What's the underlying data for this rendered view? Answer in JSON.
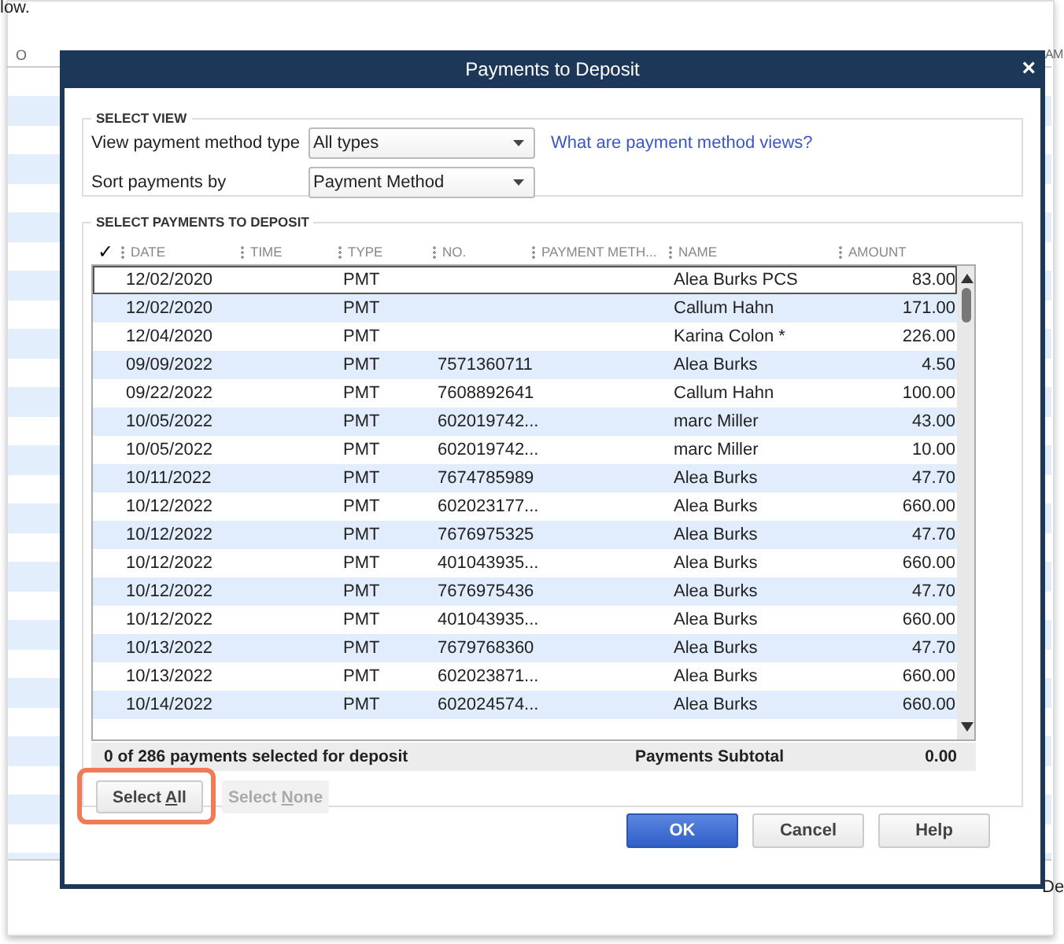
{
  "background": {
    "text_top": "low.",
    "column_left": "O",
    "column_right": "AM",
    "text_bottom": "De"
  },
  "dialog": {
    "title": "Payments to Deposit",
    "close": "×"
  },
  "select_view": {
    "legend": "SELECT VIEW",
    "fields": [
      {
        "label": "View payment method type",
        "value": "All types"
      },
      {
        "label": "Sort payments by",
        "value": "Payment Method"
      }
    ],
    "help_link": "What are payment method views?"
  },
  "payments": {
    "legend": "SELECT PAYMENTS TO DEPOSIT",
    "columns": [
      "✓",
      "DATE",
      "TIME",
      "TYPE",
      "NO.",
      "PAYMENT METH...",
      "NAME",
      "AMOUNT"
    ],
    "rows": [
      {
        "focused": true,
        "date": "12/02/2020",
        "type": "PMT",
        "no": "",
        "name": "Alea Burks PCS",
        "amount": "83.00"
      },
      {
        "focused": false,
        "date": "12/02/2020",
        "type": "PMT",
        "no": "",
        "name": "Callum Hahn",
        "amount": "171.00"
      },
      {
        "focused": false,
        "date": "12/04/2020",
        "type": "PMT",
        "no": "",
        "name": "Karina Colon *",
        "amount": "226.00"
      },
      {
        "focused": false,
        "date": "09/09/2022",
        "type": "PMT",
        "no": "7571360711",
        "name": "Alea Burks",
        "amount": "4.50"
      },
      {
        "focused": false,
        "date": "09/22/2022",
        "type": "PMT",
        "no": "7608892641",
        "name": "Callum Hahn",
        "amount": "100.00"
      },
      {
        "focused": false,
        "date": "10/05/2022",
        "type": "PMT",
        "no": "602019742...",
        "name": "marc Miller",
        "amount": "43.00"
      },
      {
        "focused": false,
        "date": "10/05/2022",
        "type": "PMT",
        "no": "602019742...",
        "name": "marc Miller",
        "amount": "10.00"
      },
      {
        "focused": false,
        "date": "10/11/2022",
        "type": "PMT",
        "no": "7674785989",
        "name": "Alea Burks",
        "amount": "47.70"
      },
      {
        "focused": false,
        "date": "10/12/2022",
        "type": "PMT",
        "no": "602023177...",
        "name": "Alea Burks",
        "amount": "660.00"
      },
      {
        "focused": false,
        "date": "10/12/2022",
        "type": "PMT",
        "no": "7676975325",
        "name": "Alea Burks",
        "amount": "47.70"
      },
      {
        "focused": false,
        "date": "10/12/2022",
        "type": "PMT",
        "no": "401043935...",
        "name": "Alea Burks",
        "amount": "660.00"
      },
      {
        "focused": false,
        "date": "10/12/2022",
        "type": "PMT",
        "no": "7676975436",
        "name": "Alea Burks",
        "amount": "47.70"
      },
      {
        "focused": false,
        "date": "10/12/2022",
        "type": "PMT",
        "no": "401043935...",
        "name": "Alea Burks",
        "amount": "660.00"
      },
      {
        "focused": false,
        "date": "10/13/2022",
        "type": "PMT",
        "no": "7679768360",
        "name": "Alea Burks",
        "amount": "47.70"
      },
      {
        "focused": false,
        "date": "10/13/2022",
        "type": "PMT",
        "no": "602023871...",
        "name": "Alea Burks",
        "amount": "660.00"
      },
      {
        "focused": false,
        "date": "10/14/2022",
        "type": "PMT",
        "no": "602024574...",
        "name": "Alea Burks",
        "amount": "660.00"
      }
    ],
    "summary": "0 of 286 payments selected for deposit",
    "subtotal_label": "Payments Subtotal",
    "subtotal": "0.00",
    "buttons": [
      {
        "label_parts": [
          "Select ",
          "A",
          "ll"
        ],
        "disabled": false,
        "highlighted": true
      },
      {
        "label_parts": [
          "Select ",
          "N",
          "one"
        ],
        "disabled": true,
        "highlighted": false
      }
    ]
  },
  "buttons": [
    {
      "label": "OK",
      "kind": "primary"
    },
    {
      "label": "Cancel",
      "kind": "default"
    },
    {
      "label": "Help",
      "kind": "default"
    }
  ]
}
